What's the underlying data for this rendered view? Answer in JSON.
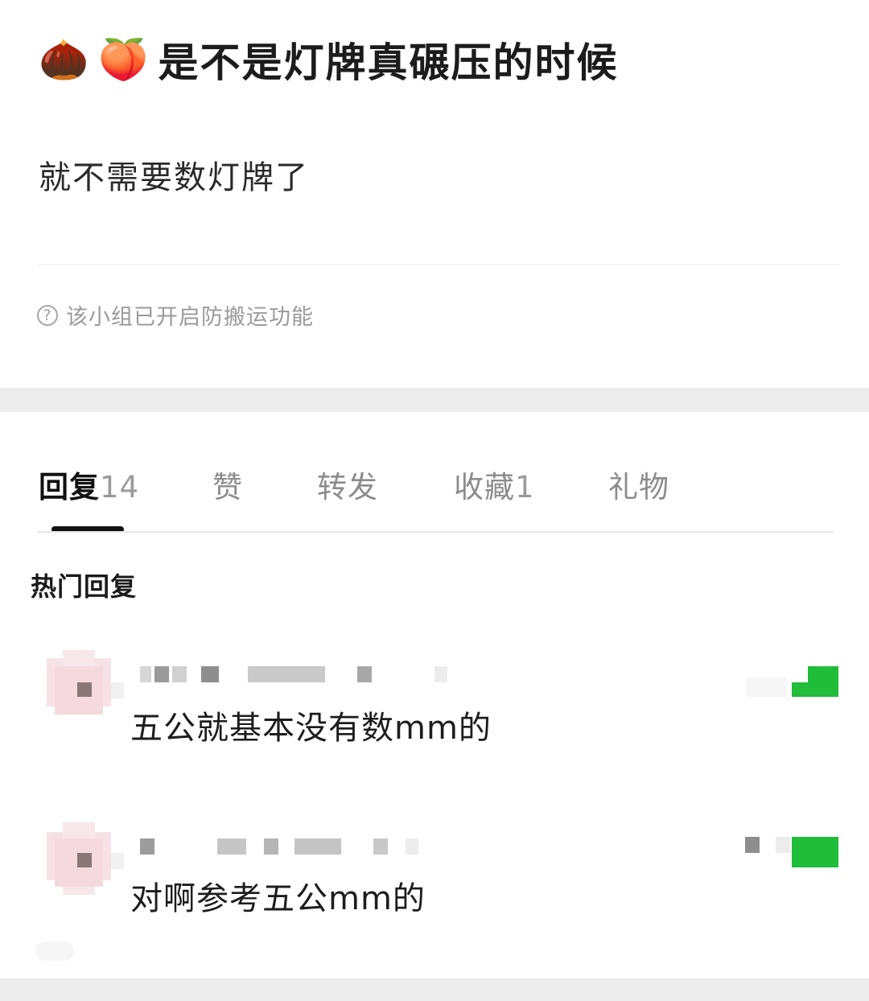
{
  "post": {
    "title_emoji_1": "🌰",
    "title_emoji_2": "🍑",
    "title": "是不是灯牌真碾压的时候",
    "body": "就不需要数灯牌了",
    "notice_icon": "question-circle-icon",
    "notice": "该小组已开启防搬运功能"
  },
  "tabs": [
    {
      "label": "回复",
      "count": "14"
    },
    {
      "label": "赞",
      "count": ""
    },
    {
      "label": "转发",
      "count": ""
    },
    {
      "label": "收藏",
      "count": "1"
    },
    {
      "label": "礼物",
      "count": ""
    }
  ],
  "section_title": "热门回复",
  "replies": [
    {
      "text": "五公就基本没有数mm的"
    },
    {
      "text": "对啊参考五公mm的"
    }
  ],
  "colors": {
    "accent_green": "#1fbd3a",
    "band_gray": "#ececec"
  }
}
